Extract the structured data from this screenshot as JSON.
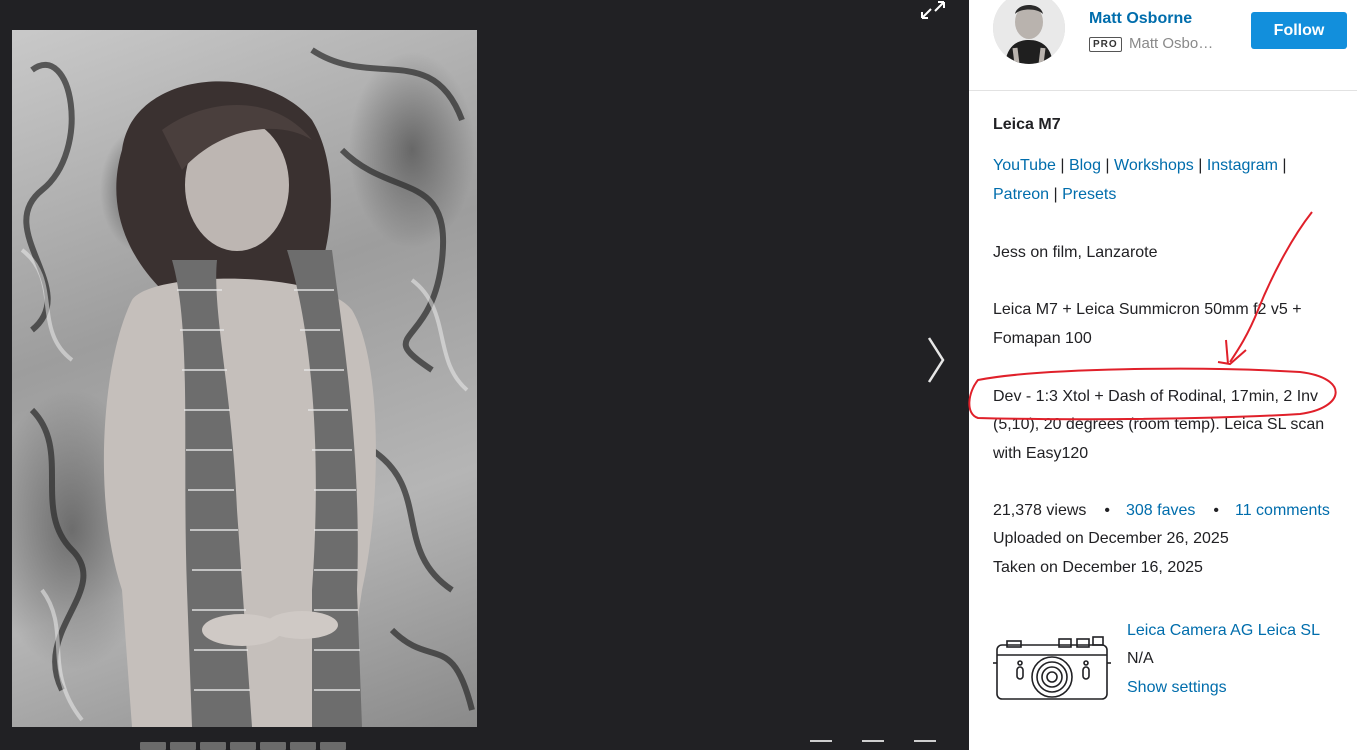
{
  "owner": {
    "name": "Matt Osborne",
    "pro_badge": "PRO",
    "handle": "Matt Osbo…",
    "follow_label": "Follow"
  },
  "photo": {
    "title": "Leica M7",
    "links": [
      "YouTube",
      "Blog",
      "Workshops",
      "Instagram",
      "Patreon",
      "Presets"
    ],
    "link_separator": "|",
    "description_lines": [
      "Jess on film, Lanzarote",
      "Leica M7 + Leica Summicron 50mm f2 v5 +",
      "Fomapan 100",
      "Dev - 1:3 Xtol + Dash of Rodinal, 17min, 2 Inv",
      "(5,10), 20 degrees (room temp). Leica SL scan",
      "with Easy120"
    ]
  },
  "stats": {
    "views": "21,378 views",
    "faves": "308 faves",
    "comments": "11 comments",
    "dot": "•",
    "uploaded": "Uploaded on December 26, 2025",
    "taken": "Taken on December 16, 2025"
  },
  "camera": {
    "name": "Leica Camera AG Leica SL",
    "lens": "N/A",
    "show_settings": "Show settings"
  },
  "icons": {
    "expand": "expand-icon",
    "next": "chevron-right-icon",
    "camera": "camera-icon"
  },
  "colors": {
    "link": "#006dac",
    "follow_button": "#128fdc",
    "viewer_background": "#212124",
    "annotation_red": "#e0202a"
  }
}
